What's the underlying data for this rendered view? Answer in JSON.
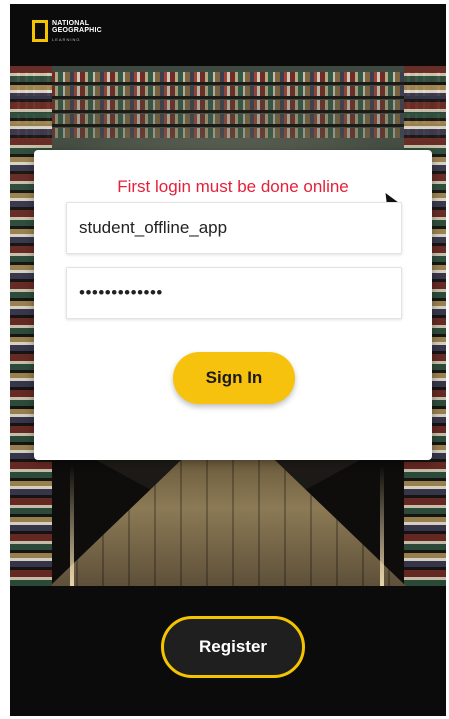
{
  "header": {
    "logo_line1": "NATIONAL",
    "logo_line2": "GEOGRAPHIC",
    "logo_line3": "LEARNING",
    "logo_color": "#f5c400"
  },
  "login_card": {
    "error_message": "First login must be done online",
    "error_color": "#e5203a",
    "username_value": "student_offline_app",
    "password_value": "•••••••••••••",
    "signin_label": "Sign In",
    "signin_color": "#f7c20e"
  },
  "footer": {
    "register_label": "Register",
    "register_border_color": "#f5c400"
  },
  "icons": {
    "cursor": "mouse-pointer-icon",
    "logo_frame": "natgeo-yellow-frame-icon"
  }
}
